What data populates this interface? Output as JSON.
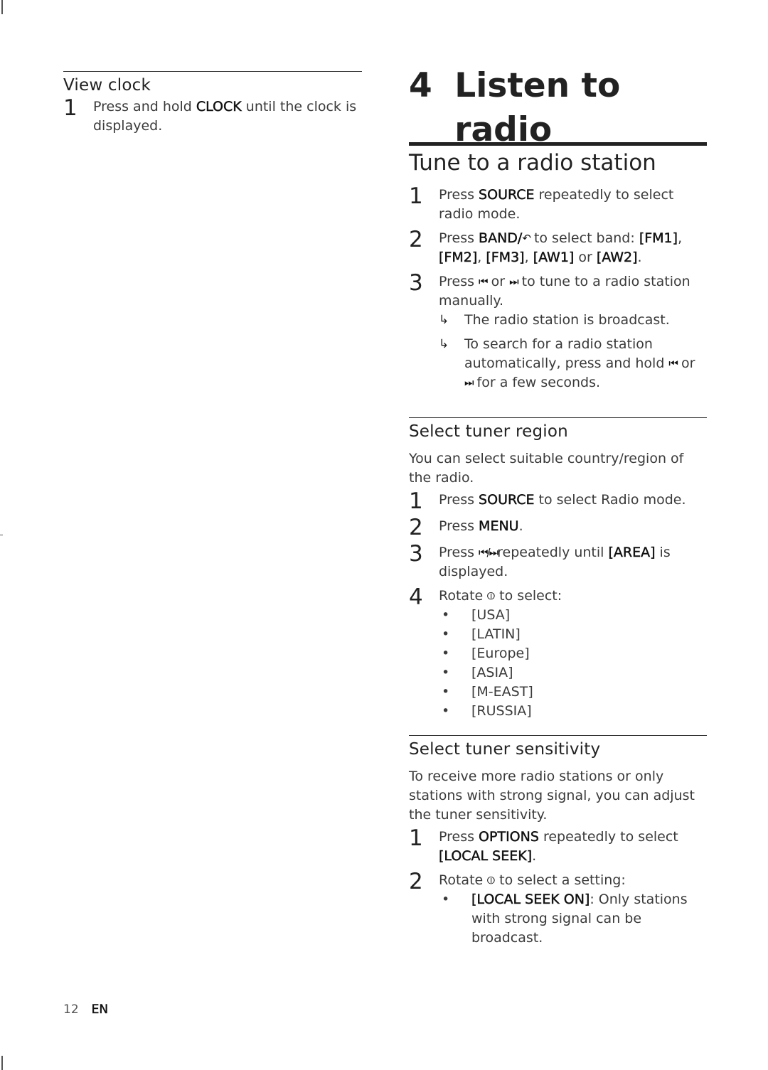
{
  "left": {
    "heading": "View clock",
    "steps": [
      {
        "num": "1",
        "pre": "Press and hold ",
        "key": "CLOCK",
        "post": " until the clock is displayed."
      }
    ]
  },
  "chapter": {
    "number": "4",
    "title": "Listen to radio"
  },
  "tune": {
    "title": "Tune to a radio station",
    "step1": {
      "num": "1",
      "pre": "Press ",
      "key": "SOURCE",
      "post": " repeatedly to select radio mode."
    },
    "step2": {
      "num": "2",
      "pre": "Press ",
      "key": "BAND/",
      "mid": " to select band: ",
      "bands": [
        "[FM1]",
        "[FM2]",
        "[FM3]",
        "[AW1]",
        "[AW2]"
      ],
      "sep1": ", ",
      "sep_or": " or ",
      "end": "."
    },
    "step3": {
      "num": "3",
      "pre": "Press ",
      "or": " or ",
      "post": " to tune to a radio station manually."
    },
    "results": [
      {
        "text": "The radio station is broadcast."
      },
      {
        "pre": "To search for a radio station automatically, press and hold ",
        "or": " or ",
        "post": " for a few seconds."
      }
    ]
  },
  "region": {
    "title": "Select tuner region",
    "intro": "You can select suitable country/region of the radio.",
    "step1": {
      "num": "1",
      "pre": "Press ",
      "key": "SOURCE",
      "post": " to select Radio mode."
    },
    "step2": {
      "num": "2",
      "pre": "Press ",
      "key": "MENU",
      "post": "."
    },
    "step3": {
      "num": "3",
      "pre": "Press ",
      "post": "repeatedly until ",
      "key": "[AREA]",
      "end": " is displayed."
    },
    "step4": {
      "num": "4",
      "pre": "Rotate ",
      "post": " to select:"
    },
    "options": [
      "[USA]",
      "[LATIN]",
      "[Europe]",
      "[ASIA]",
      "[M-EAST]",
      "[RUSSIA]"
    ]
  },
  "sensitivity": {
    "title": "Select tuner sensitivity",
    "intro": "To receive more radio stations or only stations with strong signal, you can adjust the tuner sensitivity.",
    "step1": {
      "num": "1",
      "pre": "Press ",
      "key": "OPTIONS",
      "post": " repeatedly to select ",
      "key2": "[LOCAL SEEK]",
      "end": "."
    },
    "step2": {
      "num": "2",
      "pre": "Rotate ",
      "post": " to select a setting:"
    },
    "bullets": [
      {
        "key": "[LOCAL SEEK ON]",
        "text": ": Only stations with strong signal can be broadcast."
      }
    ]
  },
  "icons": {
    "back": "↶",
    "prev": "⏮",
    "next": "⏭",
    "prev_next": "⏮/⏭",
    "knob": "⦶",
    "arrow": "↳",
    "bullet": "•"
  },
  "footer": {
    "page": "12",
    "lang": "EN"
  }
}
